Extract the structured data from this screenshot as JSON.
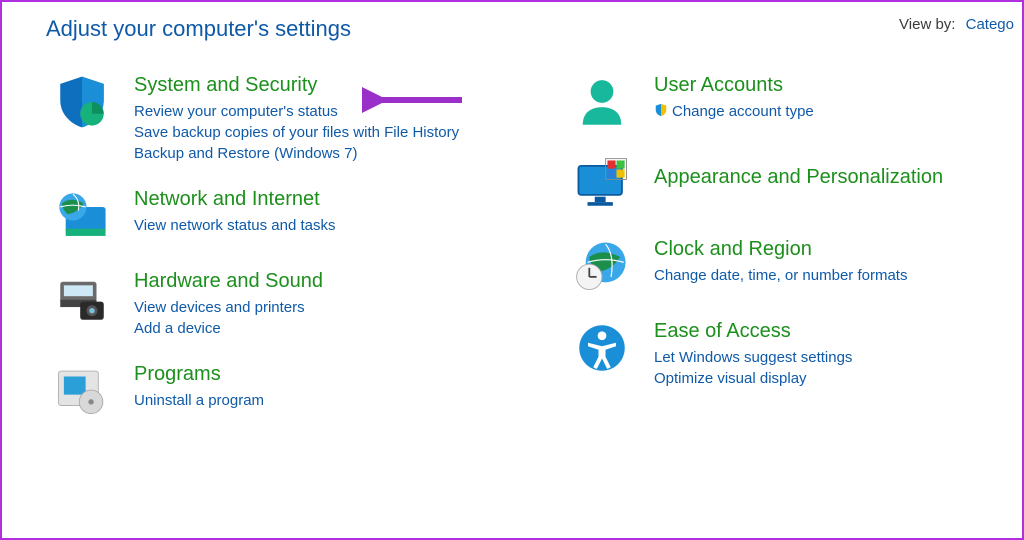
{
  "header": {
    "title": "Adjust your computer's settings",
    "viewby_label": "View by:",
    "viewby_value": "Catego"
  },
  "left": [
    {
      "id": "system-security",
      "title": "System and Security",
      "links": [
        "Review your computer's status",
        "Save backup copies of your files with File History",
        "Backup and Restore (Windows 7)"
      ]
    },
    {
      "id": "network-internet",
      "title": "Network and Internet",
      "links": [
        "View network status and tasks"
      ]
    },
    {
      "id": "hardware-sound",
      "title": "Hardware and Sound",
      "links": [
        "View devices and printers",
        "Add a device"
      ]
    },
    {
      "id": "programs",
      "title": "Programs",
      "links": [
        "Uninstall a program"
      ]
    }
  ],
  "right": [
    {
      "id": "user-accounts",
      "title": "User Accounts",
      "links": [
        "Change account type"
      ],
      "shield": [
        true
      ]
    },
    {
      "id": "appearance",
      "title": "Appearance and Personalization",
      "links": []
    },
    {
      "id": "clock-region",
      "title": "Clock and Region",
      "links": [
        "Change date, time, or number formats"
      ]
    },
    {
      "id": "ease-access",
      "title": "Ease of Access",
      "links": [
        "Let Windows suggest settings",
        "Optimize visual display"
      ]
    }
  ],
  "colors": {
    "link": "#0f5aa8",
    "category": "#1c8f1c",
    "arrow": "#9b2fc9"
  }
}
